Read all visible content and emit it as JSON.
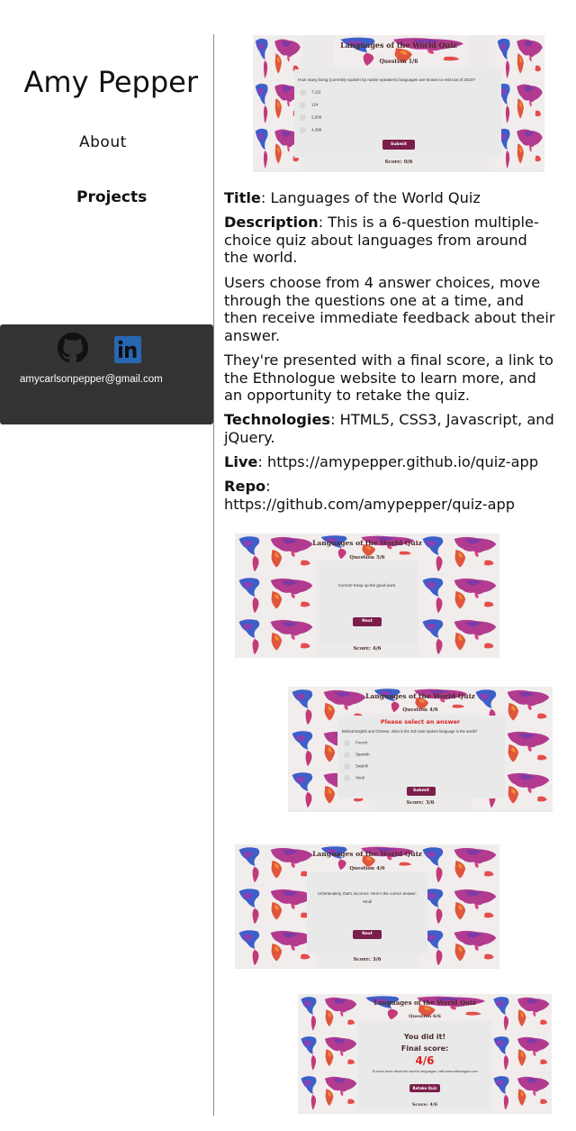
{
  "sidebar": {
    "name": "Amy Pepper",
    "nav": {
      "about": "About",
      "projects": "Projects"
    },
    "contact": {
      "email": "amycarlsonpepper@gmail.com"
    }
  },
  "project": {
    "title_label": "Title",
    "title_value": ": Languages of the World Quiz",
    "description_label": "Description",
    "description_value": ": This is a 6-question multiple-choice quiz about languages from around the world.",
    "para2": "Users choose from 4 answer choices, move through the questions one at a time, and then receive immediate feedback about their answer.",
    "para3": "They're presented with a final score, a link to the Ethnologue website to learn more, and an opportunity to retake the quiz.",
    "tech_label": "Technologies",
    "tech_value": ": HTML5, CSS3, Javascript, and jQuery.",
    "live_label": "Live",
    "live_value": ": https://amypepper.github.io/quiz-app",
    "repo_label": "Repo",
    "repo_colon": ":",
    "repo_value": "https://github.com/amypepper/quiz-app"
  },
  "screenshots": {
    "quiz_title": "Languages of the World Quiz",
    "s1": {
      "question_num": "Question 1/6",
      "question": "How many living (currently spoken by native speakers) languages are known to exist as of 2019?",
      "options": [
        "7,111",
        "124",
        "2,500",
        "4,390"
      ],
      "button": "Submit",
      "score": "Score: 0/6"
    },
    "s2": {
      "question_num": "Question 5/6",
      "feedback": "Correct! Keep up the good work.",
      "button": "Next",
      "score": "Score: 4/6"
    },
    "s3": {
      "question_num": "Question 4/6",
      "warning": "Please select an answer",
      "question": "Behind English and Chinese, what is the 3rd most spoken language in the world?",
      "options": [
        "French",
        "Spanish",
        "Swahili",
        "Hindi"
      ],
      "button": "Submit",
      "score": "Score: 3/6"
    },
    "s4": {
      "question_num": "Question 4/6",
      "feedback": "Unfortunately, that's incorrect. Here's the correct answer:",
      "answer": "Hindi",
      "button": "Next",
      "score": "Score: 3/6"
    },
    "s5": {
      "question_num": "Question 6/6",
      "done": "You did it!",
      "final_label": "Final score:",
      "final_score": "4/6",
      "learn_more": "To learn more about the world's languages, visit www.ethnologue.com",
      "button": "Retake Quiz",
      "score": "Score: 4/6"
    }
  },
  "colors": {
    "accent": "#7b1e4a",
    "contact_bg": "#333333",
    "warning": "#e02020"
  },
  "icons": [
    "github-icon",
    "linkedin-icon"
  ]
}
